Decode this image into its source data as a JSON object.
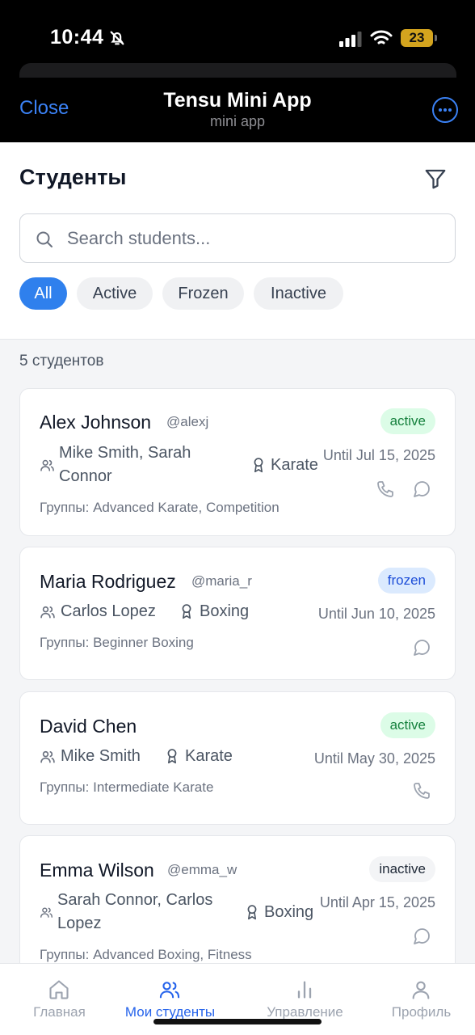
{
  "status_bar": {
    "time": "10:44",
    "battery": "23"
  },
  "app_bar": {
    "close_label": "Close",
    "title": "Tensu Mini App",
    "subtitle": "mini app"
  },
  "header": {
    "title": "Студенты",
    "search_placeholder": "Search students...",
    "filters": [
      {
        "label": "All",
        "selected": true
      },
      {
        "label": "Active",
        "selected": false
      },
      {
        "label": "Frozen",
        "selected": false
      },
      {
        "label": "Inactive",
        "selected": false
      }
    ]
  },
  "count_label": "5 студентов",
  "students": [
    {
      "name": "Alex Johnson",
      "handle": "@alexj",
      "status": "active",
      "coaches_line1": "Mike Smith, Sarah",
      "coaches_line2": "Connor",
      "sport": "Karate",
      "until": "Until Jul 15, 2025",
      "groups": "Группы: Advanced Karate, Competition",
      "actions": [
        "phone-icon",
        "chat-icon"
      ]
    },
    {
      "name": "Maria Rodriguez",
      "handle": "@maria_r",
      "status": "frozen",
      "coaches_line1": "Carlos Lopez",
      "sport": "Boxing",
      "until": "Until Jun 10, 2025",
      "groups": "Группы: Beginner Boxing",
      "actions": [
        "chat-icon"
      ]
    },
    {
      "name": "David Chen",
      "handle": "",
      "status": "active",
      "coaches_line1": "Mike Smith",
      "sport": "Karate",
      "until": "Until May 30, 2025",
      "groups": "Группы: Intermediate Karate",
      "actions": [
        "phone-icon"
      ]
    },
    {
      "name": "Emma Wilson",
      "handle": "@emma_w",
      "status": "inactive",
      "coaches_line1": "Sarah Connor, Carlos",
      "coaches_line2": "Lopez",
      "sport": "Boxing",
      "until": "Until Apr 15, 2025",
      "groups": "Группы: Advanced Boxing, Fitness",
      "actions": [
        "chat-icon"
      ]
    }
  ],
  "tabbar": [
    {
      "label": "Главная",
      "icon": "home-icon",
      "current": false
    },
    {
      "label": "Мои студенты",
      "icon": "students-icon",
      "current": true
    },
    {
      "label": "Управление",
      "icon": "chart-icon",
      "current": false
    },
    {
      "label": "Профиль",
      "icon": "profile-icon",
      "current": false
    }
  ],
  "colors": {
    "accent": "#2f80ed",
    "ios_blue": "#3b82f6",
    "active_bg": "#dcfce7",
    "frozen_bg": "#dbeafe",
    "inactive_bg": "#f3f4f6"
  }
}
